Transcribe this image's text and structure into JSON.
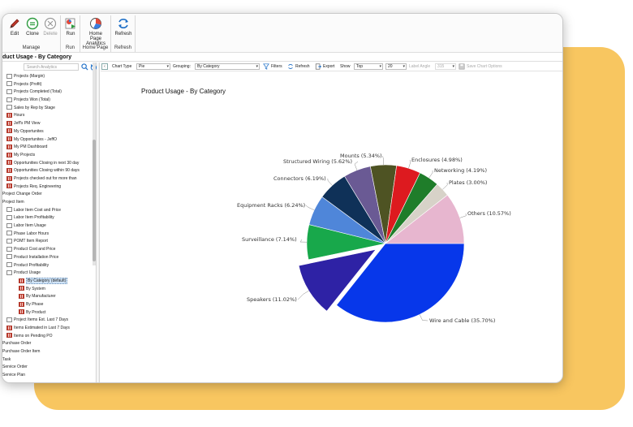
{
  "ribbon": {
    "groups": [
      {
        "label": "Manage",
        "buttons": [
          {
            "label": "Edit",
            "icon": "edit-icon"
          },
          {
            "label": "Clone",
            "icon": "clone-icon"
          },
          {
            "label": "Delete",
            "icon": "delete-icon"
          }
        ]
      },
      {
        "label": "Run",
        "buttons": [
          {
            "label": "Run",
            "icon": "run-icon"
          }
        ]
      },
      {
        "label": "Home Page",
        "buttons": [
          {
            "label": "Home Page Analytics",
            "icon": "home-page-analytics-icon"
          }
        ]
      },
      {
        "label": "Refresh",
        "buttons": [
          {
            "label": "Refresh",
            "icon": "refresh-icon"
          }
        ]
      }
    ]
  },
  "page_title": "duct Usage - By Category",
  "search": {
    "placeholder": "Search Analytics"
  },
  "tree": [
    {
      "label": "Projects (Margin)",
      "icon": "doc",
      "indent": 1
    },
    {
      "label": "Projects (Profit)",
      "icon": "doc",
      "indent": 1
    },
    {
      "label": "Projects Completed (Total)",
      "icon": "doc",
      "indent": 1
    },
    {
      "label": "Projects Won (Total)",
      "icon": "doc",
      "indent": 1
    },
    {
      "label": "Sales by Rep by Stage",
      "icon": "doc",
      "indent": 1
    },
    {
      "label": "Hours",
      "icon": "grid",
      "indent": 1
    },
    {
      "label": "Jeff's PM View",
      "icon": "grid",
      "indent": 1
    },
    {
      "label": "My Opportunites",
      "icon": "grid",
      "indent": 1
    },
    {
      "label": "My Opportunites - JeffO",
      "icon": "grid",
      "indent": 1
    },
    {
      "label": "My PM Dashboard",
      "icon": "grid",
      "indent": 1
    },
    {
      "label": "My Projects",
      "icon": "grid",
      "indent": 1
    },
    {
      "label": "Opportunities Closing in next 30 day",
      "icon": "grid",
      "indent": 1
    },
    {
      "label": "Opportunities Closing within 90 days",
      "icon": "grid",
      "indent": 1
    },
    {
      "label": "Projects checked out for more than",
      "icon": "grid",
      "indent": 1
    },
    {
      "label": "Projects Req. Engineering",
      "icon": "grid",
      "indent": 1
    },
    {
      "label": "Project Change Order",
      "icon": "none",
      "indent": 0
    },
    {
      "label": "Project Item",
      "icon": "none",
      "indent": 0
    },
    {
      "label": "Labor Item Cost and Price",
      "icon": "doc",
      "indent": 1
    },
    {
      "label": "Labor Item Profitability",
      "icon": "doc",
      "indent": 1
    },
    {
      "label": "Labor Item Usage",
      "icon": "doc",
      "indent": 1
    },
    {
      "label": "Phase Labor Hours",
      "icon": "doc",
      "indent": 1
    },
    {
      "label": "POMT Item Report",
      "icon": "doc",
      "indent": 1
    },
    {
      "label": "Product Cost and Price",
      "icon": "doc",
      "indent": 1
    },
    {
      "label": "Product Installation Price",
      "icon": "doc",
      "indent": 1
    },
    {
      "label": "Product Profitability",
      "icon": "doc",
      "indent": 1
    },
    {
      "label": "Product Usage",
      "icon": "doc",
      "indent": 1
    },
    {
      "label": "By Category (default)",
      "icon": "grid",
      "indent": 2,
      "selected": true
    },
    {
      "label": "By System",
      "icon": "grid",
      "indent": 2
    },
    {
      "label": "By Manufacturer",
      "icon": "grid",
      "indent": 2
    },
    {
      "label": "By Phase",
      "icon": "grid",
      "indent": 2
    },
    {
      "label": "By Product",
      "icon": "grid",
      "indent": 2
    },
    {
      "label": "Project Items Est. Last 7 Days",
      "icon": "doc",
      "indent": 1
    },
    {
      "label": "Items Estimated in Last 7 Days",
      "icon": "grid",
      "indent": 1
    },
    {
      "label": "Items on Pending PO",
      "icon": "grid",
      "indent": 1
    },
    {
      "label": "Purchase Order",
      "icon": "none",
      "indent": 0
    },
    {
      "label": "Purchase Order Item",
      "icon": "none",
      "indent": 0
    },
    {
      "label": "Task",
      "icon": "none",
      "indent": 0
    },
    {
      "label": "Service Order",
      "icon": "none",
      "indent": 0
    },
    {
      "label": "Service Plan",
      "icon": "none",
      "indent": 0
    }
  ],
  "toolbar": {
    "chart_type_label": "Chart Type",
    "chart_type_value": "Pie",
    "grouping_label": "Grouping:",
    "grouping_value": "By Category",
    "filters_label": "Filters",
    "refresh_label": "Refresh",
    "export_label": "Export",
    "show_label": "Show",
    "show_value": "Top",
    "count_value": "20",
    "label_angle_label": "Label Angle",
    "label_angle_value": "315",
    "save_label": "Save Chart Options"
  },
  "chart_data": {
    "type": "pie",
    "title": "Product Usage - By Category",
    "slices": [
      {
        "label": "Wire and Cable",
        "value": 35.7,
        "color": "#0737ea",
        "text": "Wire and Cable (35.70%)"
      },
      {
        "label": "Speakers",
        "value": 11.02,
        "color": "#2e22a5",
        "text": "Speakers (11.02%)",
        "exploded": true
      },
      {
        "label": "Surveillance",
        "value": 7.14,
        "color": "#18a84b",
        "text": "Surveillance (7.14%)"
      },
      {
        "label": "Equipment Racks",
        "value": 6.24,
        "color": "#4f86d9",
        "text": "Equipment Racks (6.24%)"
      },
      {
        "label": "Connectors",
        "value": 6.19,
        "color": "#0f3158",
        "text": "Connectors (6.19%)"
      },
      {
        "label": "Structured Wiring",
        "value": 5.62,
        "color": "#6a5a94",
        "text": "Structured Wiring (5.62%)"
      },
      {
        "label": "Mounts",
        "value": 5.34,
        "color": "#4e5323",
        "text": "Mounts (5.34%)"
      },
      {
        "label": "Enclosures",
        "value": 4.98,
        "color": "#dd1a1f",
        "text": "Enclosures (4.98%)"
      },
      {
        "label": "Networking",
        "value": 4.19,
        "color": "#1f7d2a",
        "text": "Networking (4.19%)"
      },
      {
        "label": "Plates",
        "value": 3.0,
        "color": "#d7d2c8",
        "text": "Plates (3.00%)"
      },
      {
        "label": "Others",
        "value": 10.57,
        "color": "#e7b6cf",
        "text": "Others (10.57%)"
      }
    ]
  }
}
